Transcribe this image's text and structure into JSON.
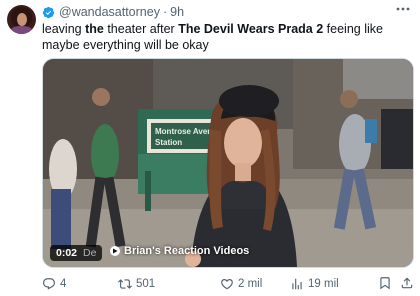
{
  "tweet": {
    "handle": "@wandasattorney",
    "separator": "·",
    "time": "9h",
    "text_prefix": "leaving ",
    "text_bold1": "the",
    "text_mid": " theater after ",
    "text_bold2": "The Devil Wears Prada 2",
    "text_suffix": " feeing like maybe everything will be okay"
  },
  "media": {
    "timecode": "0:02",
    "caption_partial": "De",
    "caption_source": "Brian's Reaction Videos",
    "station_sign_line1": "Montrose Avenue",
    "station_sign_line2": "Station"
  },
  "actions": {
    "replies": "4",
    "reposts": "501",
    "likes": "2 mil",
    "views": "19 mil"
  },
  "colors": {
    "text": "#0f1419",
    "secondary": "#536471",
    "verified": "#1d9bf0"
  }
}
